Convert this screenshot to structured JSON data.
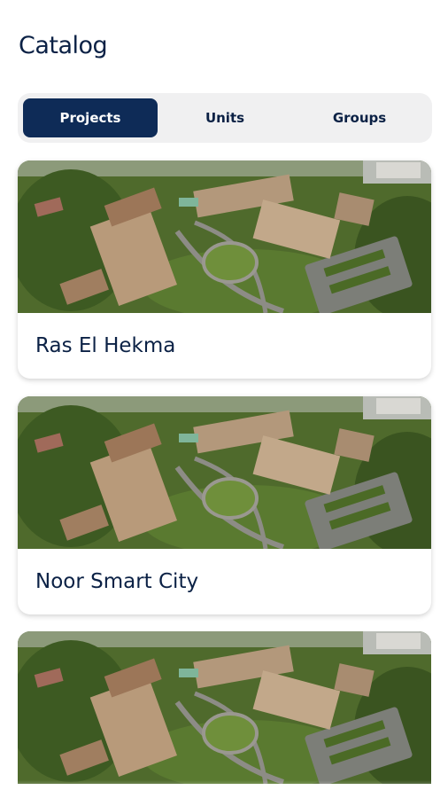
{
  "header": {
    "title": "Catalog"
  },
  "tabs": [
    {
      "label": "Projects",
      "active": true
    },
    {
      "label": "Units",
      "active": false
    },
    {
      "label": "Groups",
      "active": false
    }
  ],
  "projects": [
    {
      "name": "Ras El Hekma",
      "image": "aerial-resort-photo"
    },
    {
      "name": "Noor Smart City",
      "image": "aerial-resort-photo"
    },
    {
      "name": "",
      "image": "aerial-resort-photo"
    }
  ],
  "colors": {
    "primary": "#0e2b57",
    "text": "#0b2145",
    "segment_bg": "#f0f0f1"
  }
}
